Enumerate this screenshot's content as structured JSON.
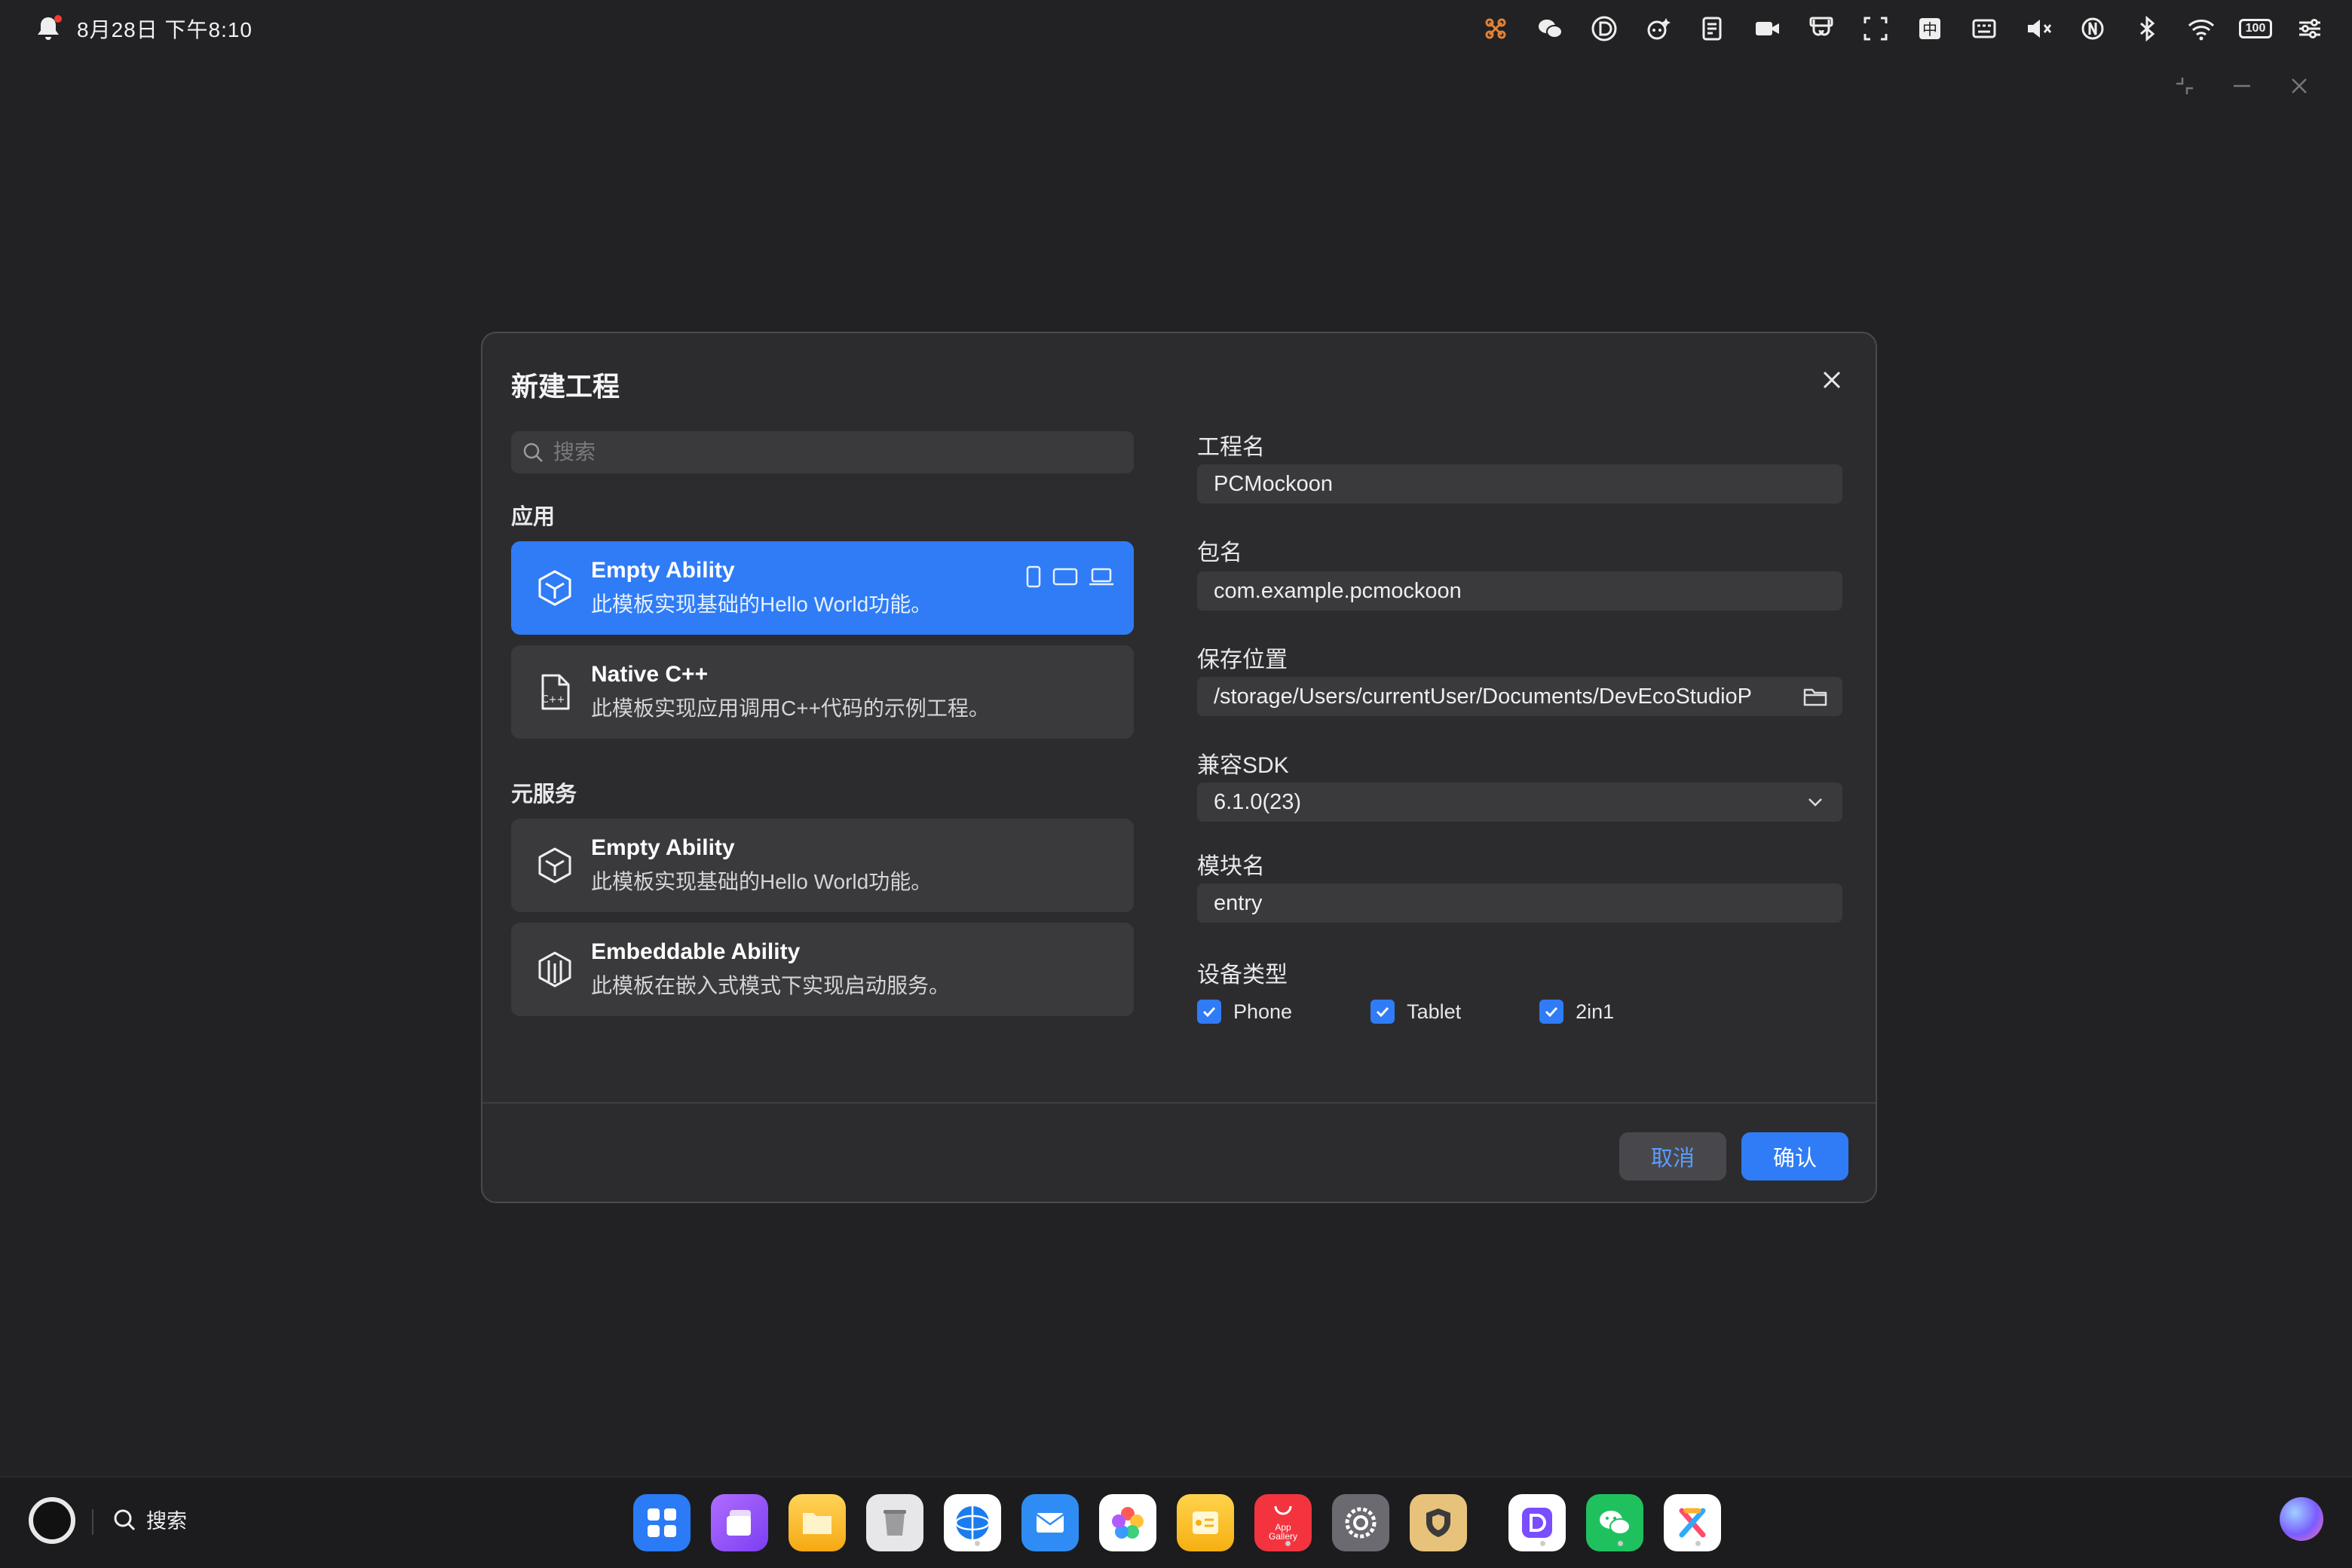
{
  "status_bar": {
    "datetime": "8月28日 下午8:10",
    "battery": "100"
  },
  "dialog": {
    "title": "新建工程",
    "search_placeholder": "搜索",
    "sections": {
      "app": "应用",
      "atomic": "元服务"
    },
    "templates": [
      {
        "name": "Empty Ability",
        "desc": "此模板实现基础的Hello World功能。",
        "icon": "cube-icon",
        "selected": true
      },
      {
        "name": "Native C++",
        "desc": "此模板实现应用调用C++代码的示例工程。",
        "icon": "cpp-file-icon",
        "selected": false
      },
      {
        "name": "Empty Ability",
        "desc": "此模板实现基础的Hello World功能。",
        "icon": "cube-icon",
        "selected": false
      },
      {
        "name": "Embeddable Ability",
        "desc": "此模板在嵌入式模式下实现启动服务。",
        "icon": "embed-icon",
        "selected": false
      }
    ],
    "form": {
      "project_name_label": "工程名",
      "project_name": "PCMockoon",
      "bundle_name_label": "包名",
      "bundle_name": "com.example.pcmockoon",
      "save_location_label": "保存位置",
      "save_location": "/storage/Users/currentUser/Documents/DevEcoStudioP",
      "sdk_label": "兼容SDK",
      "sdk_value": "6.1.0(23)",
      "module_label": "模块名",
      "module_name": "entry",
      "device_type_label": "设备类型",
      "devices": [
        {
          "label": "Phone",
          "checked": true
        },
        {
          "label": "Tablet",
          "checked": true
        },
        {
          "label": "2in1",
          "checked": true
        }
      ]
    },
    "buttons": {
      "cancel": "取消",
      "confirm": "确认"
    }
  },
  "dock": {
    "search_label": "搜索",
    "apps": [
      "launcher-grid",
      "multitask",
      "notes-folder",
      "trash",
      "browser",
      "mail",
      "gallery",
      "memo",
      "App Gallery",
      "settings",
      "security",
      "deveco",
      "wechat",
      "collab"
    ],
    "app_gallery_text": "App Gallery"
  },
  "colors": {
    "accent": "#2f7cf6",
    "dialog_bg": "#2c2c2e",
    "field_bg": "#3a3a3d",
    "desktop_bg": "#222224"
  }
}
